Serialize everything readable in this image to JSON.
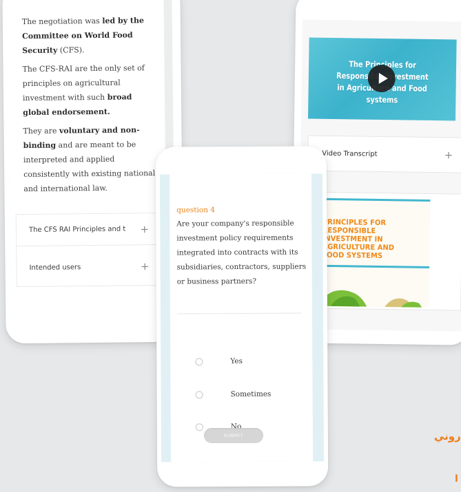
{
  "phone_left": {
    "paragraphs": [
      [
        {
          "text": "The negotiation was ",
          "bold": false
        },
        {
          "text": "led by the Committee on World Food Security",
          "bold": true
        },
        {
          "text": " (CFS).",
          "bold": false
        }
      ],
      [
        {
          "text": "The CFS-RAI are the only set of principles on agricultural investment with such ",
          "bold": false
        },
        {
          "text": "broad global endorsement.",
          "bold": true
        }
      ],
      [
        {
          "text": "They are ",
          "bold": false
        },
        {
          "text": "voluntary and non-binding",
          "bold": true
        },
        {
          "text": " and are meant to be interpreted and applied consistently with existing national and international law.",
          "bold": false
        }
      ]
    ],
    "accordion": [
      {
        "label": "The CFS RAI Principles and t",
        "icon": "+"
      },
      {
        "label": "Intended users",
        "icon": "+"
      }
    ]
  },
  "phone_right": {
    "video": {
      "title_lines": [
        "The Principles for",
        "Responsible Investment",
        "in Agriculture and Food systems"
      ],
      "play_icon": "play-icon"
    },
    "transcript": {
      "label": "Video Transcript",
      "icon": "+"
    },
    "book": {
      "title_lines": [
        "PRINCIPLES FOR",
        "RESPONSIBLE",
        "INVESTMENT IN",
        "AGRICULTURE AND",
        "FOOD SYSTEMS"
      ]
    }
  },
  "phone_front": {
    "question_label": "question 4",
    "question_text": "Are your company's responsible investment policy requirements integrated into contracts with its subsidiaries, contractors, suppliers or business partners?",
    "options": [
      "Yes",
      "Sometimes",
      "No"
    ],
    "submit_label": "SUBMIT"
  },
  "page_fragments": {
    "arabic_text": "روني",
    "arabic_text_2": "ا"
  },
  "colors": {
    "accent_orange": "#e8861c",
    "video_blue": "#4cbdd3",
    "background": "#e6e8ea"
  }
}
